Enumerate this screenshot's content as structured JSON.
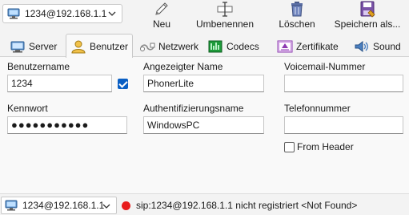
{
  "toolbar": {
    "account_select": {
      "value": "1234@192.168.1.1"
    },
    "buttons": [
      {
        "label": "Neu",
        "icon": "pencil-icon"
      },
      {
        "label": "Umbenennen",
        "icon": "rename-icon"
      },
      {
        "label": "Löschen",
        "icon": "trash-icon"
      },
      {
        "label": "Speichern als...",
        "icon": "save-icon"
      }
    ]
  },
  "tabs": [
    {
      "label": "Server",
      "icon": "server-icon",
      "active": false
    },
    {
      "label": "Benutzer",
      "icon": "user-icon",
      "active": true
    },
    {
      "label": "Netzwerk",
      "icon": "network-icon",
      "active": false
    },
    {
      "label": "Codecs",
      "icon": "codecs-icon",
      "active": false
    },
    {
      "label": "Zertifikate",
      "icon": "certificate-icon",
      "active": false
    },
    {
      "label": "Sound",
      "icon": "speaker-icon",
      "active": false
    }
  ],
  "form": {
    "username": {
      "label": "Benutzername",
      "value": "1234",
      "checkbox_checked": true
    },
    "display_name": {
      "label": "Angezeigter Name",
      "value": "PhonerLite"
    },
    "voicemail": {
      "label": "Voicemail-Nummer",
      "value": ""
    },
    "password": {
      "label": "Kennwort",
      "value": "●●●●●●●●●●●"
    },
    "auth_name": {
      "label": "Authentifizierungsname",
      "value": "WindowsPC"
    },
    "phone_number": {
      "label": "Telefonnummer",
      "value": ""
    },
    "from_header": {
      "label": "From Header",
      "checked": false
    }
  },
  "statusbar": {
    "account_select": {
      "value": "1234@192.168.1.1"
    },
    "status_color": "#e81c1c",
    "status_text": "sip:1234@192.168.1.1 nicht registriert <Not Found>"
  }
}
